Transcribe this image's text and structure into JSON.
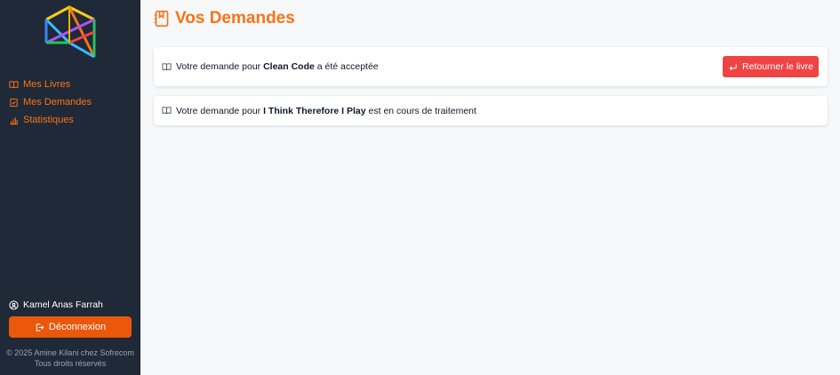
{
  "sidebar": {
    "nav": [
      {
        "label": "Mes Livres",
        "icon": "book-open-icon"
      },
      {
        "label": "Mes Demandes",
        "icon": "clipboard-check-icon"
      },
      {
        "label": "Statistiques",
        "icon": "bar-chart-icon"
      }
    ],
    "user_name": "Kamel Anas Farrah",
    "logout_label": "Déconnexion",
    "footer_line1": "© 2025 Amine Kilani chez Sofrecom",
    "footer_line2": "Tous droits réservés"
  },
  "main": {
    "title": "Vos Demandes",
    "requests": [
      {
        "prefix": "Votre demande pour ",
        "book": "Clean Code",
        "suffix": " a été acceptée",
        "action_label": "Retourner le livre"
      },
      {
        "prefix": "Votre demande pour ",
        "book": "I Think Therefore I Play",
        "suffix": " est en cours de traitement"
      }
    ]
  },
  "colors": {
    "sidebar_bg": "#1f2937",
    "accent": "#f97316",
    "logout_bg": "#ea580c",
    "return_btn": "#ef4444",
    "page_bg": "#f7f8fa"
  }
}
